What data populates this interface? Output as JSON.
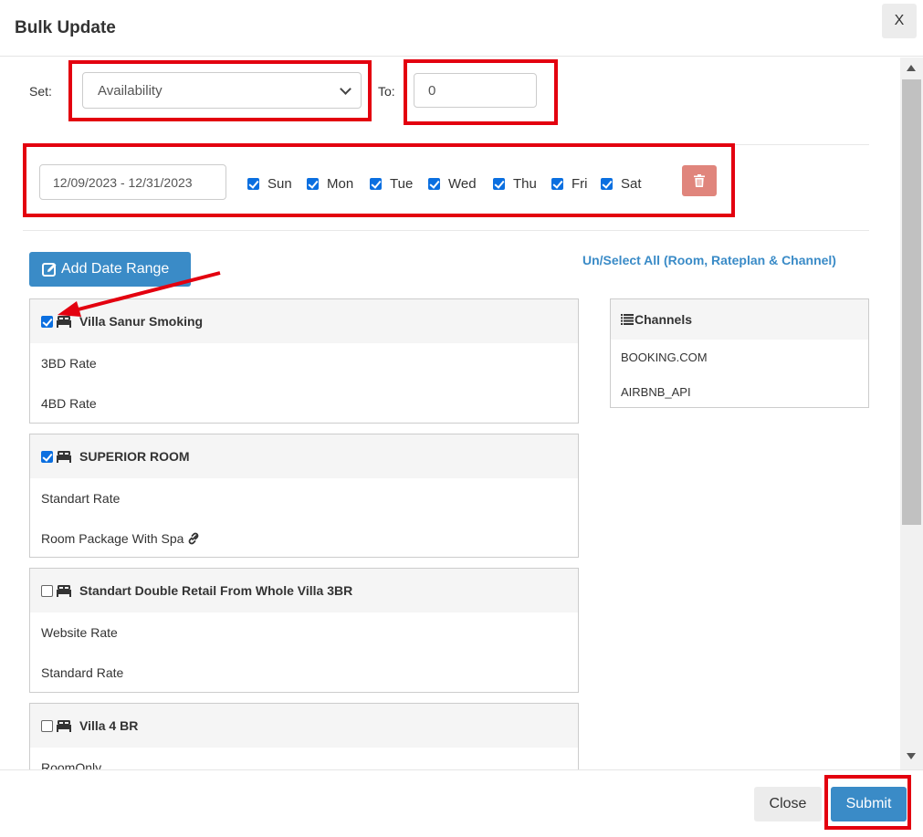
{
  "modal": {
    "title": "Bulk Update",
    "close_x": "X"
  },
  "form": {
    "set_label": "Set:",
    "set_value": "Availability",
    "to_label": "To:",
    "to_value": "0"
  },
  "date_range": {
    "value": "12/09/2023 - 12/31/2023",
    "days": [
      {
        "label": "Sun",
        "checked": true
      },
      {
        "label": "Mon",
        "checked": true
      },
      {
        "label": "Tue",
        "checked": true
      },
      {
        "label": "Wed",
        "checked": true
      },
      {
        "label": "Thu",
        "checked": true
      },
      {
        "label": "Fri",
        "checked": true
      },
      {
        "label": "Sat",
        "checked": true
      }
    ]
  },
  "actions": {
    "add_date_range": "Add Date Range",
    "unselect_all": "Un/Select All (Room, Rateplan & Channel)"
  },
  "rooms": [
    {
      "name": "Villa Sanur Smoking",
      "checked": true,
      "rates": [
        "3BD Rate",
        "4BD Rate"
      ]
    },
    {
      "name": "SUPERIOR ROOM",
      "checked": true,
      "rates": [
        "Standart Rate",
        "Room Package With Spa"
      ]
    },
    {
      "name": "Standart Double Retail From Whole Villa 3BR",
      "checked": false,
      "rates": [
        "Website Rate",
        "Standard Rate"
      ]
    },
    {
      "name": "Villa 4 BR",
      "checked": false,
      "rates": [
        "RoomOnly"
      ]
    }
  ],
  "channels": {
    "title": "Channels",
    "items": [
      "BOOKING.COM",
      "AIRBNB_API"
    ]
  },
  "footer": {
    "close": "Close",
    "submit": "Submit"
  },
  "colors": {
    "primary": "#3a8bc7",
    "danger": "#e0857c",
    "annotation": "#e3000f",
    "checkbox": "#0b6fe0"
  }
}
